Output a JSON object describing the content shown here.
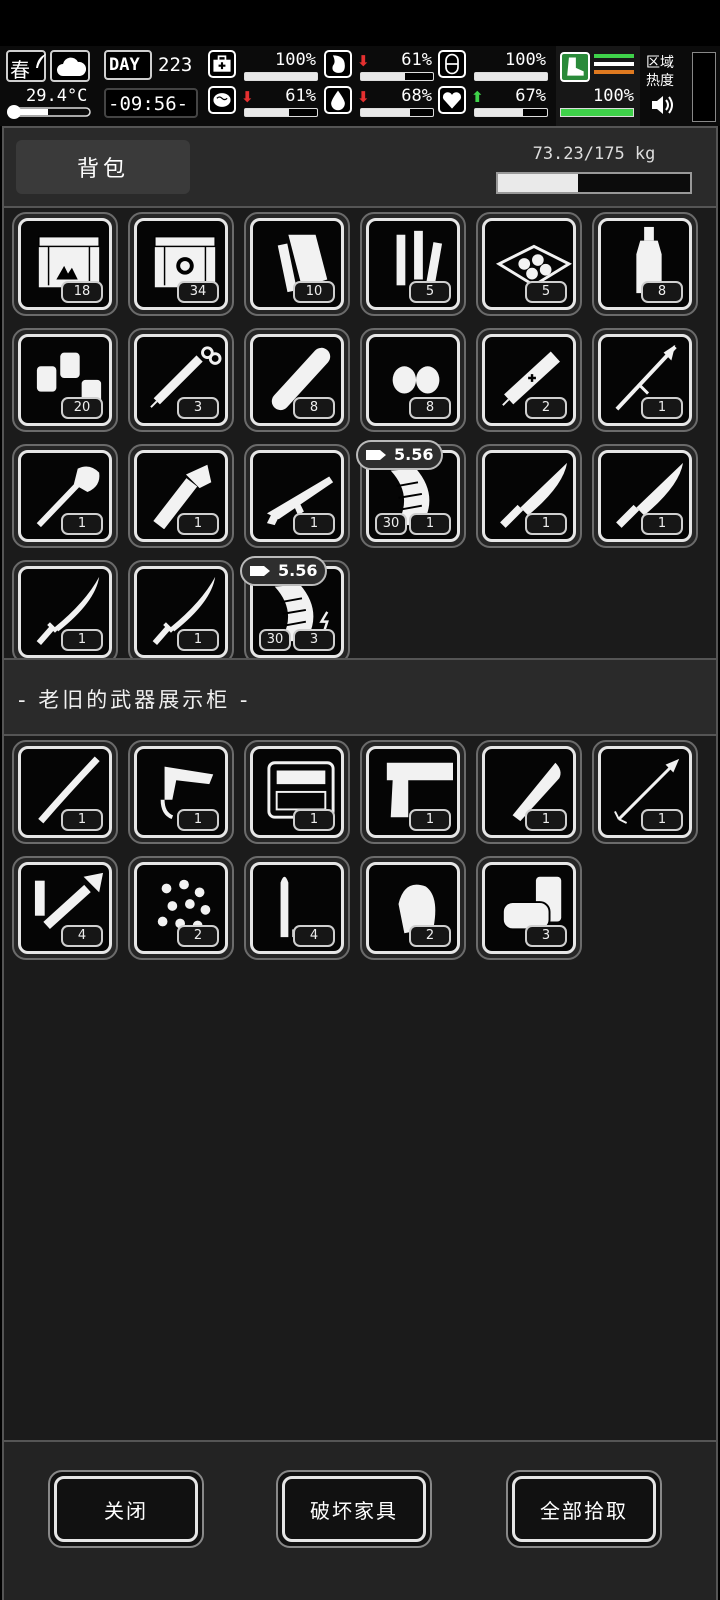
{
  "status": {
    "season": "春",
    "temperature": "29.4°C",
    "day_label": "DAY",
    "day_number": "223",
    "clock": "-09:56-",
    "stats": [
      {
        "id": "health",
        "icon": "medkit-icon",
        "value": "100%",
        "level": 1.0,
        "trend": "none"
      },
      {
        "id": "hunger",
        "icon": "stomach-icon",
        "value": "61%",
        "level": 0.61,
        "trend": "down"
      },
      {
        "id": "stamina",
        "icon": "capsule-icon",
        "value": "100%",
        "level": 1.0,
        "trend": "none"
      },
      {
        "id": "mental",
        "icon": "brain-icon",
        "value": "61%",
        "level": 0.61,
        "trend": "down"
      },
      {
        "id": "thirst",
        "icon": "water-drop-icon",
        "value": "68%",
        "level": 0.68,
        "trend": "down"
      },
      {
        "id": "mood",
        "icon": "heart-icon",
        "value": "67%",
        "level": 0.67,
        "trend": "up"
      }
    ],
    "armor_value": "100%",
    "armor_level": 1.0,
    "zone_heat_label": "区域\n热度"
  },
  "backpack": {
    "tab_label": "背包",
    "weight_text": "73.23/175 kg",
    "weight_ratio": 0.418,
    "items": [
      {
        "icon": "crate-hazard",
        "count": "18"
      },
      {
        "icon": "crate-emblem",
        "count": "34"
      },
      {
        "icon": "wire-roll",
        "count": "10"
      },
      {
        "icon": "tubes",
        "count": "5"
      },
      {
        "icon": "tray-stones",
        "count": "5"
      },
      {
        "icon": "bottle",
        "count": "8"
      },
      {
        "icon": "lanterns",
        "count": "20"
      },
      {
        "icon": "syringe",
        "count": "3"
      },
      {
        "icon": "bandage-roll",
        "count": "8"
      },
      {
        "icon": "seeds",
        "count": "8"
      },
      {
        "icon": "med-injector",
        "count": "2"
      },
      {
        "icon": "spear",
        "count": "1"
      },
      {
        "icon": "shovel",
        "count": "1"
      },
      {
        "icon": "wrench",
        "count": "1"
      },
      {
        "icon": "assault-rifle",
        "count": "1"
      },
      {
        "icon": "magazine",
        "count": "1",
        "ammo": "30",
        "caliber": "5.56"
      },
      {
        "icon": "knife",
        "count": "1"
      },
      {
        "icon": "knife",
        "count": "1"
      },
      {
        "icon": "katana",
        "count": "1"
      },
      {
        "icon": "katana",
        "count": "1"
      },
      {
        "icon": "magazine-spark",
        "count": "3",
        "ammo": "30",
        "caliber": "5.56"
      }
    ]
  },
  "container": {
    "title": "- 老旧的武器展示柜 -",
    "items": [
      {
        "icon": "staff",
        "count": "1"
      },
      {
        "icon": "gun-trigger",
        "count": "1"
      },
      {
        "icon": "toolbox",
        "count": "1"
      },
      {
        "icon": "pistol-frame",
        "count": "1"
      },
      {
        "icon": "bullet-tip",
        "count": "1"
      },
      {
        "icon": "arrow",
        "count": "1"
      },
      {
        "icon": "rocket-launcher",
        "count": "4"
      },
      {
        "icon": "pellets",
        "count": "2"
      },
      {
        "icon": "cartridge",
        "count": "4"
      },
      {
        "icon": "slug",
        "count": "2"
      },
      {
        "icon": "shotgun-shells",
        "count": "3"
      }
    ]
  },
  "footer": {
    "close_label": "关闭",
    "destroy_label": "破坏家具",
    "take_all_label": "全部拾取"
  }
}
